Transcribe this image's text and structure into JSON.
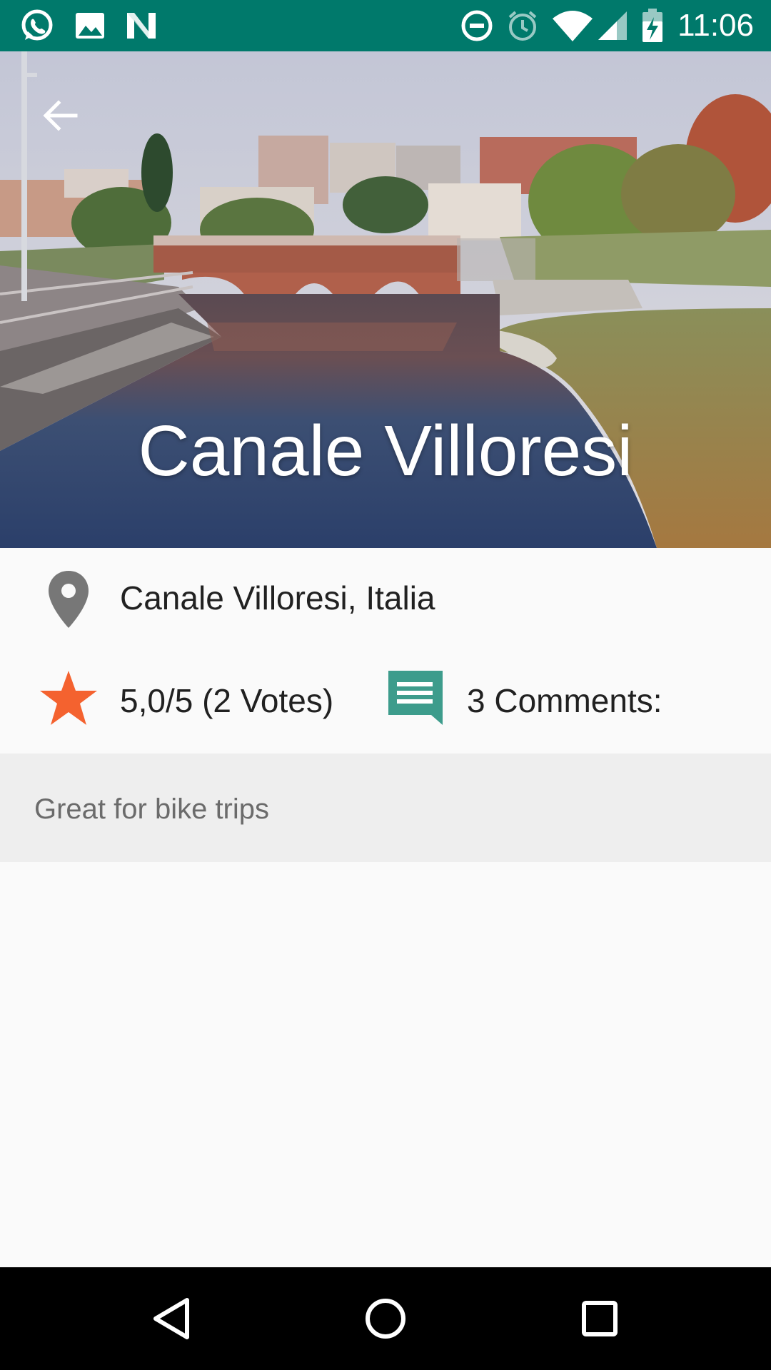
{
  "status_bar": {
    "time": "11:06",
    "left_icons": [
      "whatsapp-icon",
      "image-icon",
      "n-icon"
    ],
    "right_icons": [
      "do-not-disturb-icon",
      "alarm-icon",
      "wifi-icon",
      "signal-icon",
      "battery-charging-icon"
    ],
    "color": "#00796b"
  },
  "header": {
    "title": "Canale Villoresi",
    "back_icon": "arrow-back-icon"
  },
  "details": {
    "location": "Canale Villoresi, Italia",
    "rating": "5,0/5 (2 Votes)",
    "comments": "3 Comments:",
    "location_icon": "location-pin-icon",
    "rating_icon": "star-icon",
    "comments_icon": "comment-icon",
    "star_color": "#f4622f",
    "comment_color": "#3d9c8c"
  },
  "description": {
    "text": "Great for bike trips"
  },
  "nav_bar": {
    "icons": [
      "back-nav-icon",
      "home-nav-icon",
      "recents-nav-icon"
    ]
  }
}
